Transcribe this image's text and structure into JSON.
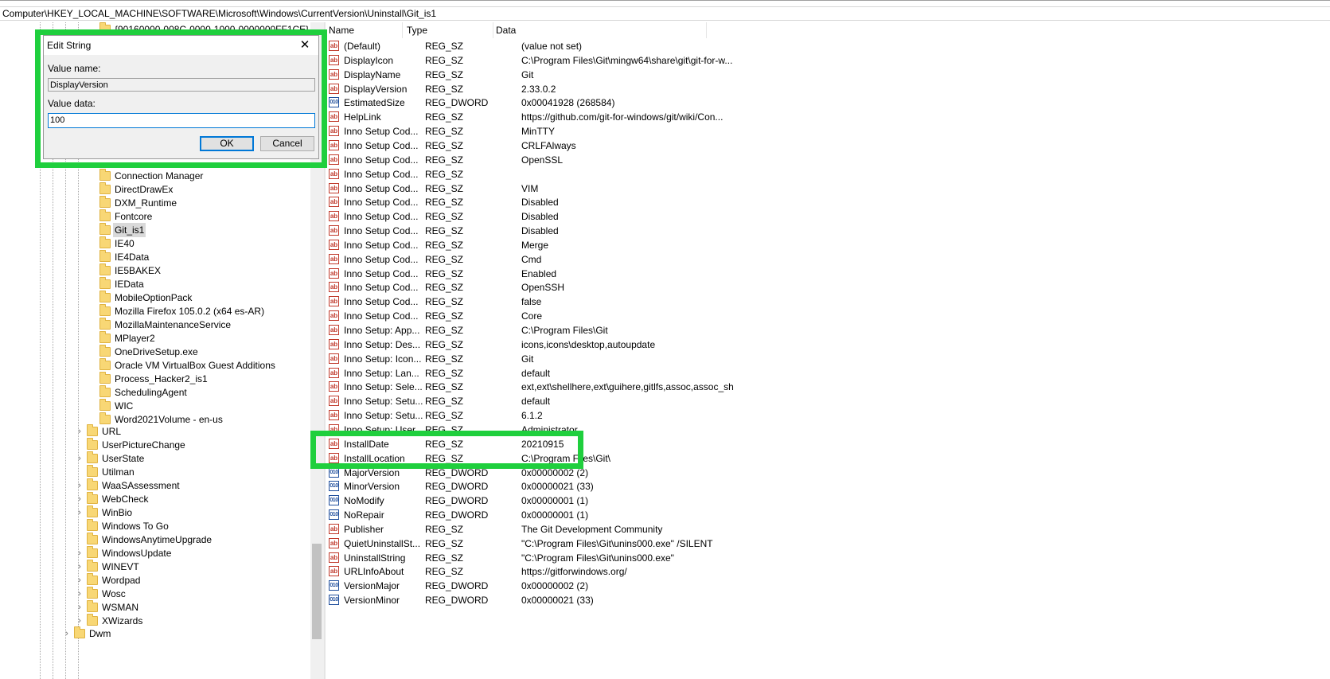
{
  "address_bar": "Computer\\HKEY_LOCAL_MACHINE\\SOFTWARE\\Microsoft\\Windows\\CurrentVersion\\Uninstall\\Git_is1",
  "tree": {
    "partial_item": "{90160000-008C-0000-1000-0000000FF1CE}",
    "uninstall_children": [
      "Connection Manager",
      "DirectDrawEx",
      "DXM_Runtime",
      "Fontcore",
      "Git_is1",
      "IE40",
      "IE4Data",
      "IE5BAKEX",
      "IEData",
      "MobileOptionPack",
      "Mozilla Firefox 105.0.2 (x64 es-AR)",
      "MozillaMaintenanceService",
      "MPlayer2",
      "OneDriveSetup.exe",
      "Oracle VM VirtualBox Guest Additions",
      "Process_Hacker2_is1",
      "SchedulingAgent",
      "WIC",
      "Word2021Volume - en-us"
    ],
    "selected": "Git_is1",
    "siblings": [
      {
        "label": "URL",
        "expandable": true
      },
      {
        "label": "UserPictureChange",
        "expandable": false
      },
      {
        "label": "UserState",
        "expandable": true
      },
      {
        "label": "Utilman",
        "expandable": false
      },
      {
        "label": "WaaSAssessment",
        "expandable": true
      },
      {
        "label": "WebCheck",
        "expandable": true
      },
      {
        "label": "WinBio",
        "expandable": true
      },
      {
        "label": "Windows To Go",
        "expandable": false
      },
      {
        "label": "WindowsAnytimeUpgrade",
        "expandable": false
      },
      {
        "label": "WindowsUpdate",
        "expandable": true
      },
      {
        "label": "WINEVT",
        "expandable": true
      },
      {
        "label": "Wordpad",
        "expandable": true
      },
      {
        "label": "Wosc",
        "expandable": true
      },
      {
        "label": "WSMAN",
        "expandable": true
      },
      {
        "label": "XWizards",
        "expandable": true
      }
    ],
    "bottom_item": "Dwm"
  },
  "list": {
    "headers": {
      "name": "Name",
      "type": "Type",
      "data": "Data"
    },
    "rows": [
      {
        "icon": "ab",
        "name": "(Default)",
        "type": "REG_SZ",
        "data": "(value not set)"
      },
      {
        "icon": "ab",
        "name": "DisplayIcon",
        "type": "REG_SZ",
        "data": "C:\\Program Files\\Git\\mingw64\\share\\git\\git-for-w..."
      },
      {
        "icon": "ab",
        "name": "DisplayName",
        "type": "REG_SZ",
        "data": "Git"
      },
      {
        "icon": "ab",
        "name": "DisplayVersion",
        "type": "REG_SZ",
        "data": "2.33.0.2"
      },
      {
        "icon": "bin",
        "name": "EstimatedSize",
        "type": "REG_DWORD",
        "data": "0x00041928 (268584)"
      },
      {
        "icon": "ab",
        "name": "HelpLink",
        "type": "REG_SZ",
        "data": "https://github.com/git-for-windows/git/wiki/Con..."
      },
      {
        "icon": "ab",
        "name": "Inno Setup Cod...",
        "type": "REG_SZ",
        "data": "MinTTY"
      },
      {
        "icon": "ab",
        "name": "Inno Setup Cod...",
        "type": "REG_SZ",
        "data": "CRLFAlways"
      },
      {
        "icon": "ab",
        "name": "Inno Setup Cod...",
        "type": "REG_SZ",
        "data": "OpenSSL"
      },
      {
        "icon": "ab",
        "name": "Inno Setup Cod...",
        "type": "REG_SZ",
        "data": ""
      },
      {
        "icon": "ab",
        "name": "Inno Setup Cod...",
        "type": "REG_SZ",
        "data": "VIM"
      },
      {
        "icon": "ab",
        "name": "Inno Setup Cod...",
        "type": "REG_SZ",
        "data": "Disabled"
      },
      {
        "icon": "ab",
        "name": "Inno Setup Cod...",
        "type": "REG_SZ",
        "data": "Disabled"
      },
      {
        "icon": "ab",
        "name": "Inno Setup Cod...",
        "type": "REG_SZ",
        "data": "Disabled"
      },
      {
        "icon": "ab",
        "name": "Inno Setup Cod...",
        "type": "REG_SZ",
        "data": "Merge"
      },
      {
        "icon": "ab",
        "name": "Inno Setup Cod...",
        "type": "REG_SZ",
        "data": "Cmd"
      },
      {
        "icon": "ab",
        "name": "Inno Setup Cod...",
        "type": "REG_SZ",
        "data": "Enabled"
      },
      {
        "icon": "ab",
        "name": "Inno Setup Cod...",
        "type": "REG_SZ",
        "data": "OpenSSH"
      },
      {
        "icon": "ab",
        "name": "Inno Setup Cod...",
        "type": "REG_SZ",
        "data": "false"
      },
      {
        "icon": "ab",
        "name": "Inno Setup Cod...",
        "type": "REG_SZ",
        "data": "Core"
      },
      {
        "icon": "ab",
        "name": "Inno Setup: App...",
        "type": "REG_SZ",
        "data": "C:\\Program Files\\Git"
      },
      {
        "icon": "ab",
        "name": "Inno Setup: Des...",
        "type": "REG_SZ",
        "data": "icons,icons\\desktop,autoupdate"
      },
      {
        "icon": "ab",
        "name": "Inno Setup: Icon...",
        "type": "REG_SZ",
        "data": "Git"
      },
      {
        "icon": "ab",
        "name": "Inno Setup: Lan...",
        "type": "REG_SZ",
        "data": "default"
      },
      {
        "icon": "ab",
        "name": "Inno Setup: Sele...",
        "type": "REG_SZ",
        "data": "ext,ext\\shellhere,ext\\guihere,gitlfs,assoc,assoc_sh"
      },
      {
        "icon": "ab",
        "name": "Inno Setup: Setu...",
        "type": "REG_SZ",
        "data": "default"
      },
      {
        "icon": "ab",
        "name": "Inno Setup: Setu...",
        "type": "REG_SZ",
        "data": "6.1.2"
      },
      {
        "icon": "ab",
        "name": "Inno Setup: User",
        "type": "REG_SZ",
        "data": "Administrator"
      },
      {
        "icon": "ab",
        "name": "InstallDate",
        "type": "REG_SZ",
        "data": "20210915"
      },
      {
        "icon": "ab",
        "name": "InstallLocation",
        "type": "REG_SZ",
        "data": "C:\\Program Files\\Git\\"
      },
      {
        "icon": "bin",
        "name": "MajorVersion",
        "type": "REG_DWORD",
        "data": "0x00000002 (2)"
      },
      {
        "icon": "bin",
        "name": "MinorVersion",
        "type": "REG_DWORD",
        "data": "0x00000021 (33)"
      },
      {
        "icon": "bin",
        "name": "NoModify",
        "type": "REG_DWORD",
        "data": "0x00000001 (1)"
      },
      {
        "icon": "bin",
        "name": "NoRepair",
        "type": "REG_DWORD",
        "data": "0x00000001 (1)"
      },
      {
        "icon": "ab",
        "name": "Publisher",
        "type": "REG_SZ",
        "data": "The Git Development Community"
      },
      {
        "icon": "ab",
        "name": "QuietUninstallSt...",
        "type": "REG_SZ",
        "data": "\"C:\\Program Files\\Git\\unins000.exe\" /SILENT"
      },
      {
        "icon": "ab",
        "name": "UninstallString",
        "type": "REG_SZ",
        "data": "\"C:\\Program Files\\Git\\unins000.exe\""
      },
      {
        "icon": "ab",
        "name": "URLInfoAbout",
        "type": "REG_SZ",
        "data": "https://gitforwindows.org/"
      },
      {
        "icon": "bin",
        "name": "VersionMajor",
        "type": "REG_DWORD",
        "data": "0x00000002 (2)"
      },
      {
        "icon": "bin",
        "name": "VersionMinor",
        "type": "REG_DWORD",
        "data": "0x00000021 (33)"
      }
    ]
  },
  "icons": {
    "string_value": "ab",
    "binary_value": "010"
  },
  "dialog": {
    "title": "Edit String",
    "close_glyph": "✕",
    "value_name_label": "Value name:",
    "value_name": "DisplayVersion",
    "value_data_label": "Value data:",
    "value_data": "100",
    "ok_label": "OK",
    "cancel_label": "Cancel"
  },
  "highlight_color": "#1fcf3d"
}
